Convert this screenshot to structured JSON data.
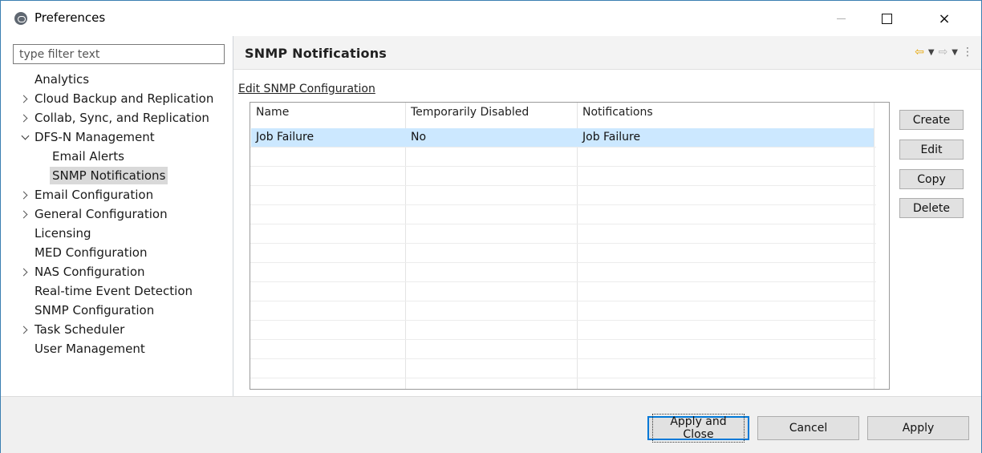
{
  "window": {
    "title": "Preferences",
    "icon": "app-logo-icon",
    "controls": {
      "minimize": "minimize-icon",
      "maximize": "maximize-icon",
      "close": "×"
    }
  },
  "sidebar": {
    "filter_placeholder": "type filter text",
    "items": [
      {
        "label": "Analytics",
        "expander": "none"
      },
      {
        "label": "Cloud Backup and Replication",
        "expander": "collapsed"
      },
      {
        "label": "Collab, Sync, and Replication",
        "expander": "collapsed"
      },
      {
        "label": "DFS-N Management",
        "expander": "expanded"
      },
      {
        "label": "Email Alerts",
        "expander": "none",
        "child": true
      },
      {
        "label": "SNMP Notifications",
        "expander": "none",
        "child": true,
        "selected": true
      },
      {
        "label": "Email Configuration",
        "expander": "collapsed"
      },
      {
        "label": "General Configuration",
        "expander": "collapsed"
      },
      {
        "label": "Licensing",
        "expander": "none"
      },
      {
        "label": "MED Configuration",
        "expander": "none"
      },
      {
        "label": "NAS Configuration",
        "expander": "collapsed"
      },
      {
        "label": "Real-time Event Detection",
        "expander": "none"
      },
      {
        "label": "SNMP Configuration",
        "expander": "none"
      },
      {
        "label": "Task Scheduler",
        "expander": "collapsed"
      },
      {
        "label": "User Management",
        "expander": "none"
      }
    ]
  },
  "main": {
    "title": "SNMP Notifications",
    "nav": {
      "back": "⇦",
      "forward": "⇨",
      "dropdown": "▼",
      "menu": "⋮"
    },
    "section_link": "Edit SNMP Configuration",
    "table": {
      "columns": [
        "Name",
        "Temporarily Disabled",
        "Notifications"
      ],
      "rows": [
        {
          "name": "Job Failure",
          "disabled": "No",
          "notifications": "Job Failure",
          "selected": true
        }
      ]
    },
    "buttons": {
      "create": "Create",
      "edit": "Edit",
      "copy": "Copy",
      "delete": "Delete"
    }
  },
  "footer": {
    "apply_close": "Apply and Close",
    "cancel": "Cancel",
    "apply": "Apply"
  },
  "colors": {
    "selection": "#cce8ff",
    "tree_selection": "#d9d9d9",
    "default_button_border": "#0078d7",
    "nav_back": "#e6a400"
  }
}
